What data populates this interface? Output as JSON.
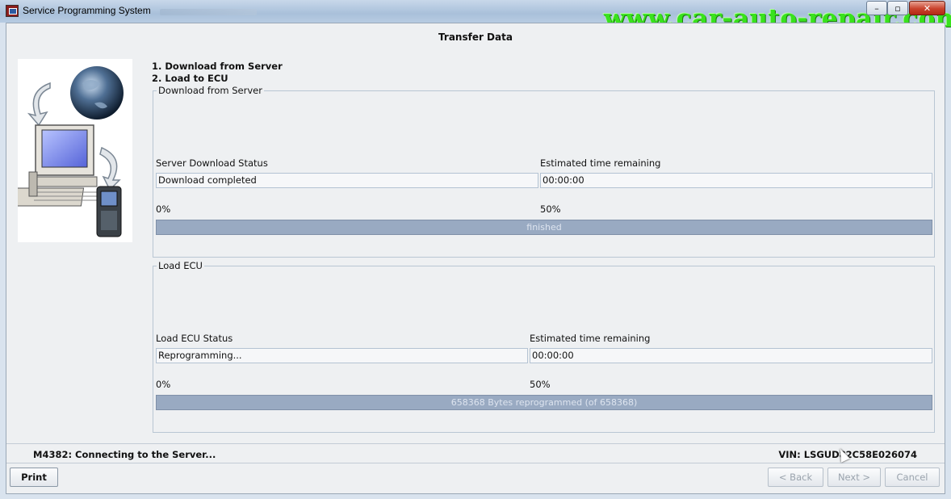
{
  "window": {
    "title": "Service Programming System",
    "watermark": "www.car-auto-repair.com",
    "controls": {
      "minimize": "–",
      "maximize": "▫",
      "close": "✕"
    }
  },
  "page": {
    "heading": "Transfer Data",
    "steps": [
      "1. Download from Server",
      "2. Load to ECU"
    ]
  },
  "download": {
    "legend": "Download from Server",
    "status_label": "Server Download Status",
    "eta_label": "Estimated time remaining",
    "status_value": "Download completed",
    "eta_value": "00:00:00",
    "min_label": "0%",
    "mid_label": "50%",
    "progress_fraction": 1.0,
    "progress_text": "finished"
  },
  "load_ecu": {
    "legend": "Load ECU",
    "status_label": "Load ECU Status",
    "eta_label": "Estimated time remaining",
    "status_value": "Reprogramming...",
    "eta_value": "00:00:00",
    "min_label": "0%",
    "mid_label": "50%",
    "progress_fraction": 1.0,
    "progress_text": "658368 Bytes reprogrammed (of 658368)"
  },
  "status_bar": {
    "message": "M4382: Connecting to the Server...",
    "vin": "VIN: LSGUD82C58E026074"
  },
  "buttons": {
    "print": "Print",
    "back": "< Back",
    "next": "Next >",
    "cancel": "Cancel"
  },
  "colors": {
    "accent_watermark": "#39e21d",
    "progress_fill": "#99aac2",
    "close_button": "#c9422c"
  }
}
